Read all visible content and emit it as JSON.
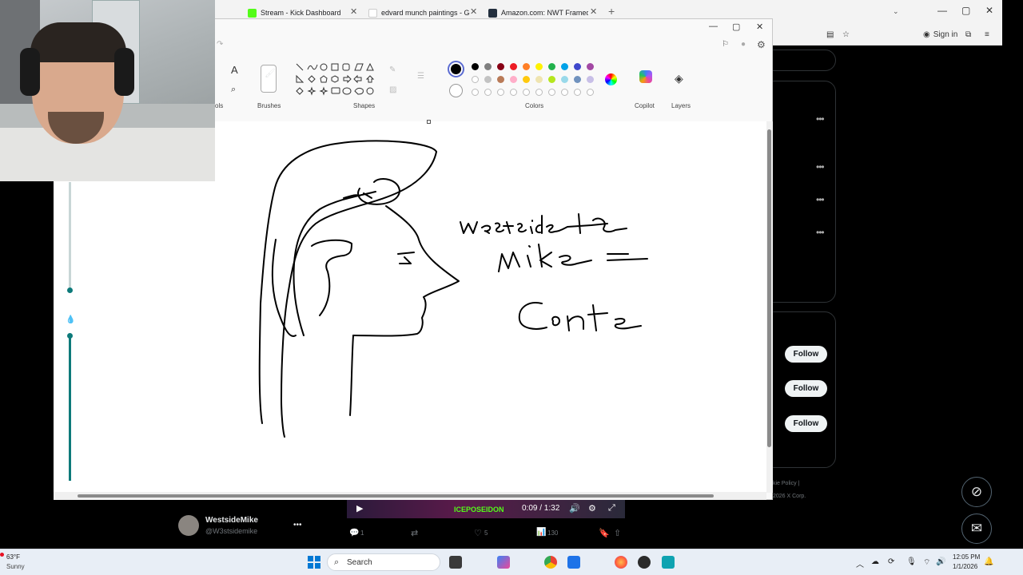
{
  "browser": {
    "tabs": [
      {
        "label": "Stream - Kick Dashboard"
      },
      {
        "label": "edvard munch paintings - Goog"
      },
      {
        "label": "Amazon.com: NWT Framed Car"
      }
    ],
    "new_tab": "+",
    "sign_in": "Sign in",
    "tab_close": "✕",
    "win": {
      "min": "—",
      "max": "▢",
      "close": "✕"
    }
  },
  "paint": {
    "ribbon": {
      "tools_label": "ols",
      "brushes_label": "Brushes",
      "shapes_label": "Shapes",
      "colors_label": "Colors",
      "copilot_label": "Copilot",
      "layers_label": "Layers"
    },
    "colors": {
      "row1": [
        "#000000",
        "#7f7f7f",
        "#880015",
        "#ed1c24",
        "#ff7f27",
        "#fff200",
        "#22b14c",
        "#00a2e8",
        "#3f48cc",
        "#a349a4"
      ],
      "row2": [
        "#ffffff",
        "#c3c3c3",
        "#b97a57",
        "#ffaec9",
        "#ffc90e",
        "#efe4b0",
        "#b5e61d",
        "#99d9ea",
        "#7092be",
        "#c8bfe7"
      ]
    },
    "canvas_text": {
      "line1": "westside",
      "line2": "mike =",
      "line3": "Conte"
    }
  },
  "xsidebar": {
    "follow_label": "Follow",
    "footer_line1": "kie Policy |",
    "footer_line2": "2026 X Corp."
  },
  "tweet": {
    "display_name": "WestsideMike",
    "handle": "@W3stsidemike",
    "video_time": "0:09 / 1:32",
    "video_channel": "ICEPOSEIDON",
    "replies": "1",
    "likes": "5",
    "views": "130"
  },
  "taskbar": {
    "weather_temp": "63°F",
    "weather_desc": "Sunny",
    "search_label": "Search",
    "time": "12:05 PM",
    "date": "1/1/2026"
  }
}
